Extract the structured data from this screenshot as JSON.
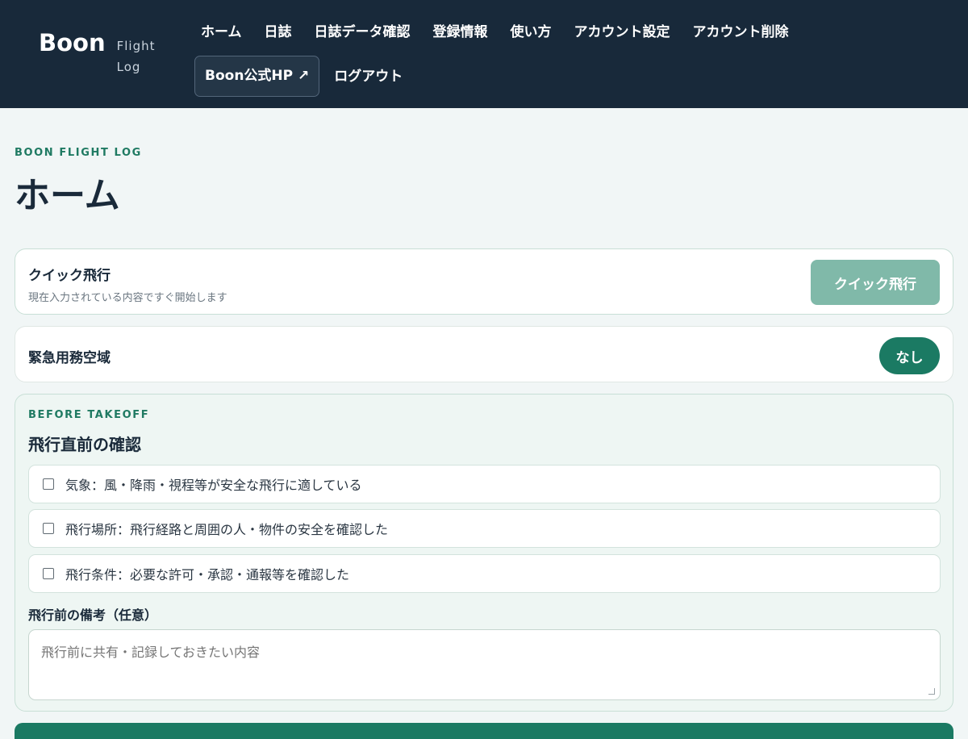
{
  "brand": {
    "name": "Boon",
    "sub": "Flight Log"
  },
  "nav": {
    "row1": [
      "ホーム",
      "日誌",
      "日誌データ確認",
      "登録情報",
      "使い方",
      "アカウント設定",
      "アカウント削除"
    ],
    "official_hp": "Boon公式HP ↗",
    "logout": "ログアウト"
  },
  "page": {
    "eyebrow": "BOON FLIGHT LOG",
    "title": "ホーム"
  },
  "quick_flight": {
    "title": "クイック飛行",
    "desc": "現在入力されている内容ですぐ開始します",
    "button": "クイック飛行"
  },
  "emergency": {
    "title": "緊急用務空域",
    "status": "なし"
  },
  "before_takeoff": {
    "eyebrow": "BEFORE TAKEOFF",
    "title": "飛行直前の確認",
    "checks": [
      "気象：風・降雨・視程等が安全な飛行に適している",
      "飛行場所：飛行経路と周囲の人・物件の安全を確認した",
      "飛行条件：必要な許可・承認・通報等を確認した"
    ],
    "notes_label": "飛行前の備考（任意）",
    "notes_placeholder": "飛行前に共有・記録しておきたい内容"
  }
}
